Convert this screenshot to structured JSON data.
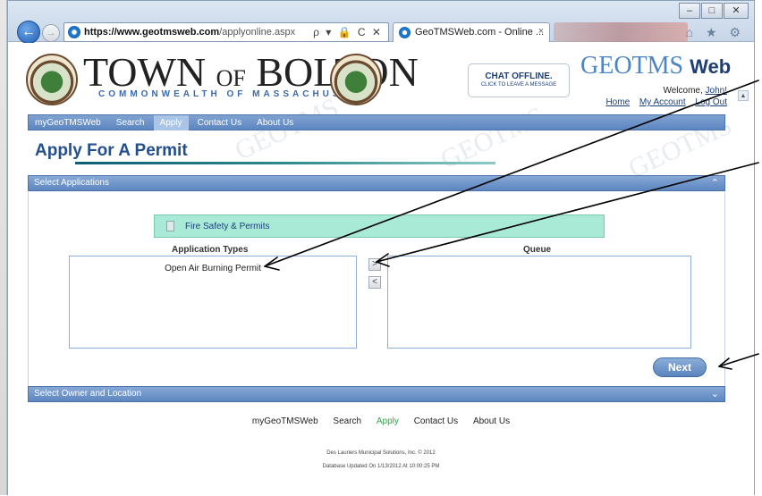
{
  "browser": {
    "url_domain": "https://www.geotmsweb.com",
    "url_path": "/applyonline.aspx",
    "address_tools": "ρ ▾ 🔒 C ✕",
    "tab_title": "GeoTMSWeb.com - Online ...",
    "tab_close": "×",
    "window_buttons": [
      "–",
      "□",
      "✕"
    ],
    "toolbar_icons": "⌂ ★ ⚙"
  },
  "header": {
    "town_name_part1": "TOWN",
    "town_name_of": "OF",
    "town_name_part2": "BOLTON",
    "commonwealth": "COMMONWEALTH OF MASSACHUSETTS",
    "chat_status": "CHAT OFFLINE.",
    "chat_link": "CLICK TO LEAVE A MESSAGE",
    "geo_brand": "GEOTMS",
    "geo_brand_web": "Web",
    "welcome_prefix": "Welcome, ",
    "welcome_user": "John!",
    "links": [
      "Home",
      "My Account",
      "Log Out"
    ]
  },
  "nav": {
    "items": [
      {
        "label": "myGeoTMSWeb",
        "active": false
      },
      {
        "label": "Search",
        "active": false
      },
      {
        "label": "Apply",
        "active": true
      },
      {
        "label": "Contact Us",
        "active": false
      },
      {
        "label": "About Us",
        "active": false
      }
    ]
  },
  "main": {
    "page_title": "Apply For A Permit",
    "sections": {
      "select_applications": "Select Applications",
      "select_owner_location": "Select Owner and Location"
    },
    "category_label": "Fire Safety & Permits",
    "application_types_header": "Application Types",
    "queue_header": "Queue",
    "application_types": [
      "Open Air Burning Permit"
    ],
    "move_right": ">",
    "move_left": "<",
    "next_button": "Next"
  },
  "footer": {
    "links": [
      {
        "label": "myGeoTMSWeb",
        "active": false
      },
      {
        "label": "Search",
        "active": false
      },
      {
        "label": "Apply",
        "active": true
      },
      {
        "label": "Contact Us",
        "active": false
      },
      {
        "label": "About Us",
        "active": false
      }
    ],
    "copyright": "Des Lauriers Municipal Solutions, Inc. © 2012",
    "db_updated": "Database Updated On 1/13/2012 At 10:00:25 PM"
  },
  "colors": {
    "nav_blue": "#5d86c0",
    "title_blue": "#234f8e",
    "category_green": "#a8ead5",
    "active_link_green": "#3aa14b"
  }
}
